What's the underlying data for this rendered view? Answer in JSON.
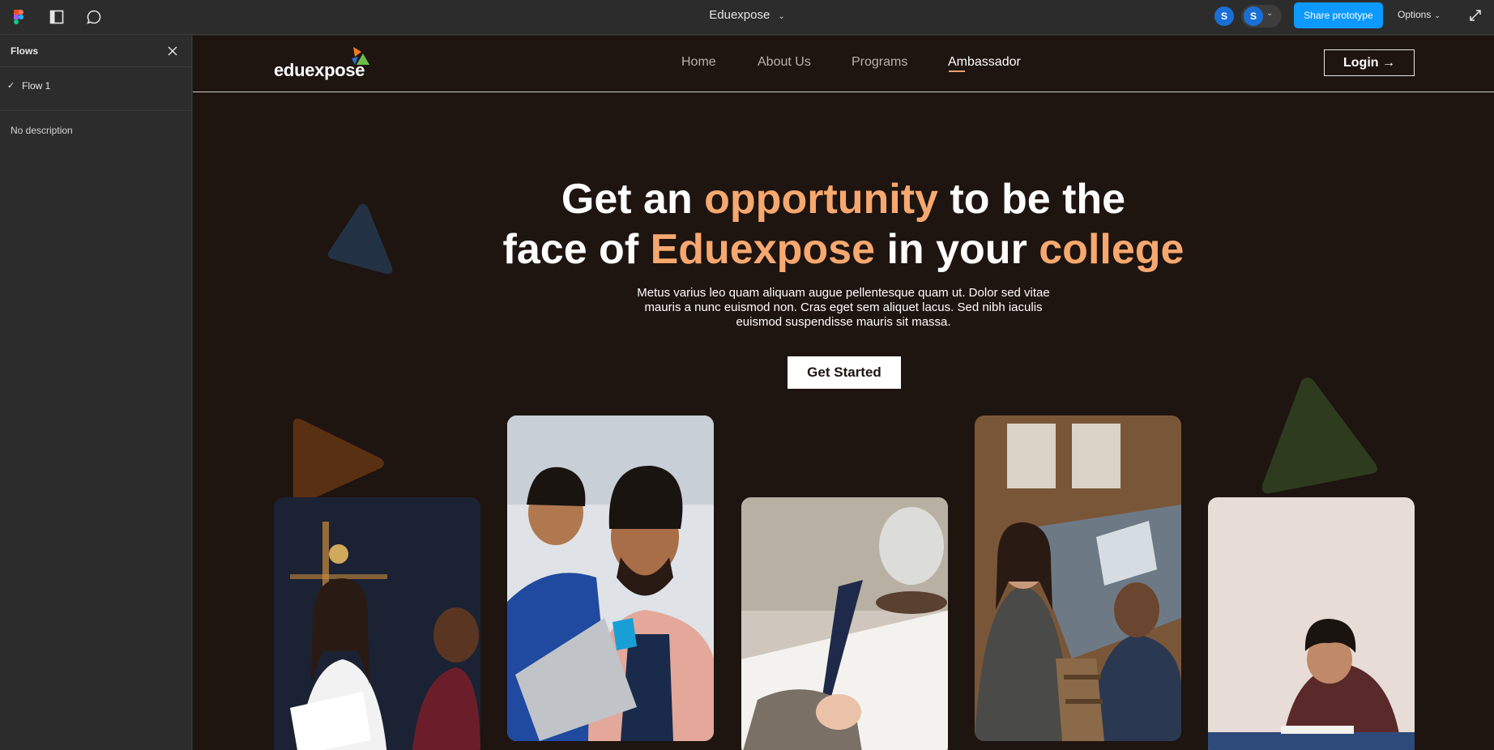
{
  "app": {
    "file_title": "Eduexpose",
    "share_label": "Share prototype",
    "options_label": "Options",
    "avatars": [
      "S",
      "S"
    ],
    "colors": {
      "toolbar_bg": "#2c2c2c",
      "share_blue": "#0d99ff",
      "avatar_blue": "#1a6fd6"
    }
  },
  "sidebar": {
    "title": "Flows",
    "flows": [
      {
        "label": "Flow 1",
        "selected": true
      }
    ],
    "description": "No description"
  },
  "site": {
    "logo_text": "eduexpose",
    "nav": [
      "Home",
      "About Us",
      "Programs",
      "Ambassador"
    ],
    "active_nav": "Ambassador",
    "login_label": "Login →",
    "hero": {
      "line1_a": "Get an ",
      "line1_b": "opportunity",
      "line1_c": " to be the",
      "line2_a": "face of ",
      "line2_b": "Eduexpose",
      "line2_c": " in your ",
      "line2_d": "college",
      "subtitle": "Metus varius leo quam aliquam augue pellentesque quam ut. Dolor sed vitae mauris a nunc euismod non. Cras eget sem aliquet lacus. Sed nibh iaculis euismod suspendisse mauris sit massa.",
      "cta_label": "Get Started"
    },
    "colors": {
      "background": "#1e1410",
      "accent": "#f6a86f"
    },
    "photos": [
      "students-reviewing-papers",
      "two-students-at-laptop",
      "hand-writing-notes",
      "students-working-on-laptops",
      "student-studying-at-desk"
    ]
  }
}
